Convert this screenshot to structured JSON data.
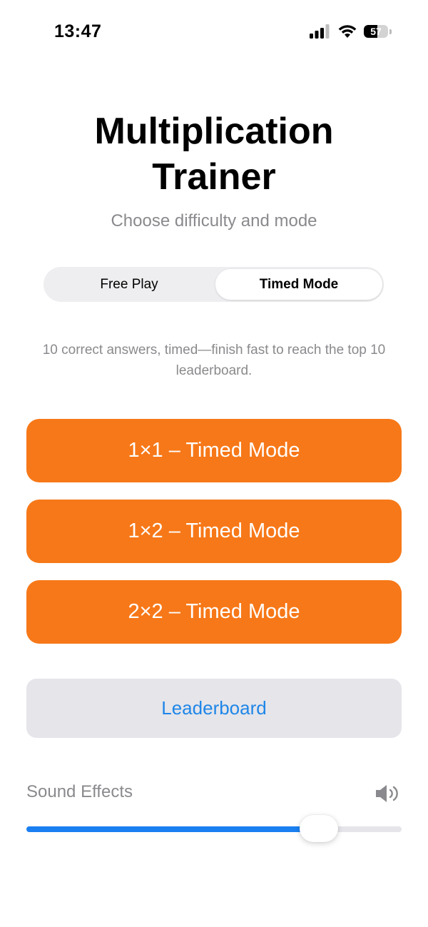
{
  "status_bar": {
    "time": "13:47",
    "battery_level": "57",
    "icons": [
      "signal-icon",
      "wifi-icon",
      "battery-icon"
    ]
  },
  "header": {
    "title_line1": "Multiplication",
    "title_line2": "Trainer",
    "subtitle": "Choose difficulty and mode"
  },
  "mode_selector": {
    "options": [
      "Free Play",
      "Timed Mode"
    ],
    "selected": "Timed Mode"
  },
  "description": "10 correct answers, timed—finish fast to reach the top 10 leaderboard.",
  "buttons": [
    {
      "label": "1×1 – Timed Mode"
    },
    {
      "label": "1×2 – Timed Mode"
    },
    {
      "label": "2×2 – Timed Mode"
    }
  ],
  "leaderboard_label": "Leaderboard",
  "sound": {
    "label": "Sound Effects",
    "icon": "speaker-volume-icon",
    "volume_fraction": 0.78
  },
  "colors": {
    "accent_orange": "#f77818",
    "link_blue": "#1f86e8",
    "slider_blue": "#1a7ff0",
    "secondary_text": "#8a8a8e",
    "button_gray": "#e5e5ea"
  }
}
